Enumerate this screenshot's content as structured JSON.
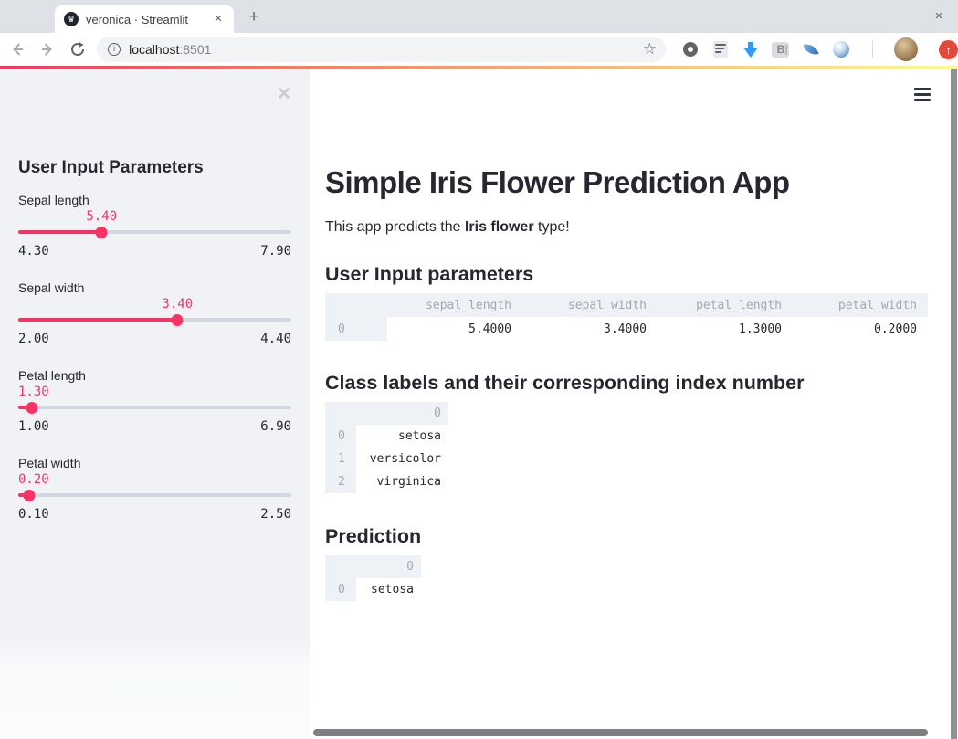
{
  "browser": {
    "tab": {
      "title": "veronica · Streamlit",
      "close_label": "×",
      "favicon_glyph": "♛"
    },
    "new_tab_label": "+",
    "window_close_label": "×",
    "url": {
      "host": "localhost",
      "port": ":8501"
    },
    "bookmark_star": "☆",
    "info_glyph": "i",
    "ext_b_label": "B",
    "update_glyph": "↑",
    "toolbar_icons": [
      "back-arrow",
      "forward-arrow",
      "refresh",
      "page-info",
      "bookmark-star",
      "extension-donut",
      "extension-binary-doc",
      "extension-download-arrow",
      "extension-b",
      "extension-feather",
      "extension-swirl",
      "profile-avatar",
      "browser-update"
    ]
  },
  "sidebar": {
    "close_label": "×",
    "heading": "User Input Parameters",
    "sliders": [
      {
        "label": "Sepal length",
        "value": "5.40",
        "min": "4.30",
        "max": "7.90"
      },
      {
        "label": "Sepal width",
        "value": "3.40",
        "min": "2.00",
        "max": "4.40"
      },
      {
        "label": "Petal length",
        "value": "1.30",
        "min": "1.00",
        "max": "6.90"
      },
      {
        "label": "Petal width",
        "value": "0.20",
        "min": "0.10",
        "max": "2.50"
      }
    ]
  },
  "main": {
    "menu_icon": "hamburger-menu",
    "title": "Simple Iris Flower Prediction App",
    "intro": {
      "prefix": "This app predicts the ",
      "bold": "Iris flower",
      "suffix": " type!"
    },
    "user_input_section": {
      "heading": "User Input parameters",
      "table": {
        "columns": [
          "sepal_length",
          "sepal_width",
          "petal_length",
          "petal_width"
        ],
        "rows": [
          {
            "index": "0",
            "values": [
              "5.4000",
              "3.4000",
              "1.3000",
              "0.2000"
            ]
          }
        ]
      }
    },
    "class_labels_section": {
      "heading": "Class labels and their corresponding index number",
      "table": {
        "columns": [
          "0"
        ],
        "rows": [
          {
            "index": "0",
            "values": [
              "setosa"
            ]
          },
          {
            "index": "1",
            "values": [
              "versicolor"
            ]
          },
          {
            "index": "2",
            "values": [
              "virginica"
            ]
          }
        ]
      }
    },
    "prediction_section": {
      "heading": "Prediction",
      "table": {
        "columns": [
          "0"
        ],
        "rows": [
          {
            "index": "0",
            "values": [
              "setosa"
            ]
          }
        ]
      }
    }
  },
  "colors": {
    "accent": "#f63366",
    "decoration_gradient_start": "#f63366",
    "decoration_gradient_end": "#fffd80",
    "sidebar_bg": "#f0f2f6",
    "dark_text": "#262730",
    "table_muted_text": "#a3a8b4"
  }
}
